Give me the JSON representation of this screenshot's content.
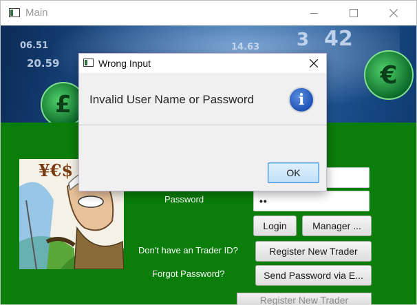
{
  "window": {
    "title": "Main",
    "banner_numbers": [
      "42",
      "06.51",
      "20.59",
      "14.63",
      "3"
    ],
    "banner_coin_symbols": [
      "£",
      "€"
    ]
  },
  "login": {
    "username_value": "",
    "password_label": "Password",
    "password_value": "••",
    "login_button": "Login",
    "manager_button": "Manager ...",
    "no_trader_text": "Don't have an Trader ID?",
    "register_button": "Register New Trader",
    "forgot_text": "Forgot Password?",
    "send_password_button": "Send Password via E...",
    "cartoon_sign": "¥€$",
    "background_register_button": "Register New Trader"
  },
  "dialog": {
    "title": "Wrong Input",
    "message": "Invalid User Name or Password",
    "ok_button": "OK",
    "info_glyph": "i"
  },
  "colors": {
    "green_background": "#0a7d0a",
    "ok_button_border": "#3c8ed8",
    "info_icon_blue": "#1e52b5"
  }
}
